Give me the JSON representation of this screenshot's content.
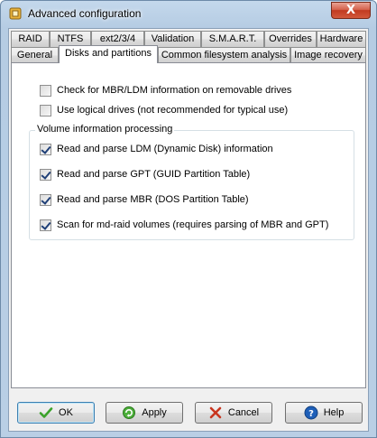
{
  "window": {
    "title": "Advanced configuration",
    "close_label": "X"
  },
  "tabs_row1": [
    "RAID",
    "NTFS",
    "ext2/3/4",
    "Validation",
    "S.M.A.R.T.",
    "Overrides",
    "Hardware"
  ],
  "tabs_row2": [
    "General",
    "Disks and partitions",
    "Common filesystem analysis",
    "Image recovery"
  ],
  "active_tab": "Disks and partitions",
  "options": {
    "mbr_ldm_removable": {
      "label": "Check for MBR/LDM information on removable drives",
      "checked": false
    },
    "logical_drives": {
      "label": "Use logical drives (not recommended for typical use)",
      "checked": false
    }
  },
  "volume_group": {
    "title": "Volume information processing",
    "items": [
      {
        "label": "Read and parse LDM (Dynamic Disk) information",
        "checked": true
      },
      {
        "label": "Read and parse GPT (GUID Partition Table)",
        "checked": true
      },
      {
        "label": "Read and parse MBR (DOS Partition Table)",
        "checked": true
      },
      {
        "label": "Scan for md-raid volumes (requires parsing of MBR and GPT)",
        "checked": true
      }
    ]
  },
  "buttons": {
    "ok": "OK",
    "apply": "Apply",
    "cancel": "Cancel",
    "help": "Help"
  },
  "colors": {
    "check": "#1f3f77",
    "ok_icon": "#3aa22a",
    "cancel_icon": "#c8351f",
    "help_icon": "#1e5fb8",
    "close_button": "#c13a20"
  },
  "icons": {
    "app": "app-config-icon",
    "ok": "checkmark-icon",
    "apply": "apply-refresh-icon",
    "cancel": "cancel-x-icon",
    "help": "help-question-icon"
  }
}
